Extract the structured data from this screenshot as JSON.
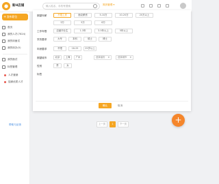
{
  "topbar": {
    "brand": "新H店铺",
    "search_placeholder": "输入姓名、手机号搜索",
    "link": "简历管理 ▾"
  },
  "sidebar": {
    "primary_button": "发布职位",
    "items": [
      {
        "label": "首页"
      },
      {
        "label": "我的人才(7824)"
      },
      {
        "label": "我的待面试"
      },
      {
        "label": "我的待办(0)"
      },
      {
        "label": "我的面试"
      },
      {
        "label": "标签管理"
      },
      {
        "label": "人才营销"
      },
      {
        "label": "独家优质人才"
      }
    ],
    "footer_link": "帮助与反馈"
  },
  "filters": {
    "rows": [
      {
        "label": "期望年薪",
        "options": [
          "不限工资",
          "面议薪资",
          "5-10万",
          "10-20万",
          "20万以上"
        ],
        "selected": 0
      },
      {
        "label": "",
        "options": [
          "3万",
          "5万",
          "8万"
        ],
        "selected": -1
      },
      {
        "label": "工作年限",
        "options": [
          "应届毕业生",
          "1-3年",
          "3-5年以上",
          "5年以上"
        ],
        "selected": -1
      },
      {
        "label": "学历要求",
        "options": [
          "大专",
          "本科",
          "硕士",
          "博士"
        ],
        "selected": -1
      },
      {
        "label": "年龄要求",
        "options": [
          "不限",
          "18-25",
          "25岁以上"
        ],
        "selected": -1
      },
      {
        "label": "期望城市",
        "options": [
          "北京",
          "上海",
          "广州"
        ],
        "selected": -1,
        "selects": [
          "选择省份",
          "选择城市"
        ]
      },
      {
        "label": "性别",
        "options": [
          "男",
          "女"
        ],
        "selected": -1
      },
      {
        "label": "标签",
        "options": [],
        "selected": -1
      }
    ],
    "confirm_label": "确认",
    "cancel_label": "取消"
  },
  "pagination": {
    "prev": "上一页",
    "current": "1",
    "next": "下一页"
  },
  "fab": {
    "label": "+"
  }
}
